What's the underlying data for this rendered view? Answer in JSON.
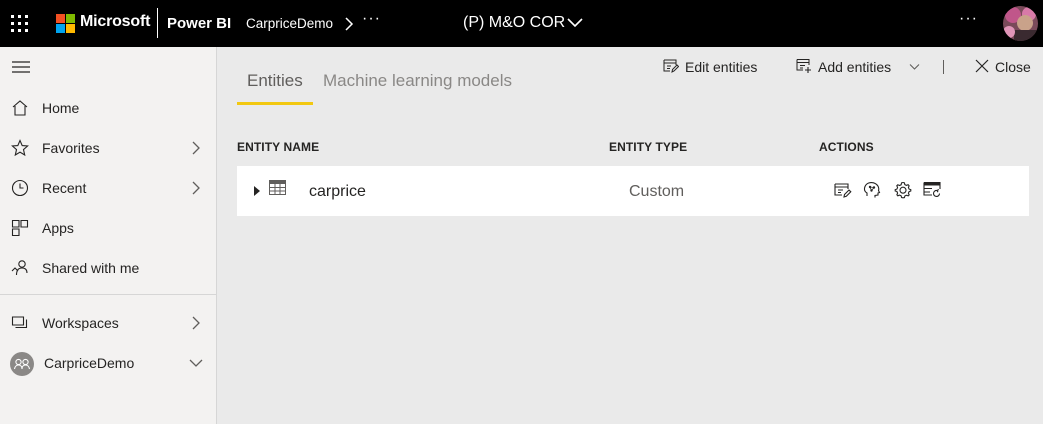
{
  "topbar": {
    "brand": "Microsoft",
    "app_name": "Power BI",
    "workspace": "CarpriceDemo",
    "crumb_more": "···",
    "environment": "(P) M&O COR",
    "more": "···"
  },
  "leftnav": {
    "items": [
      {
        "label": "Home",
        "icon": "home-icon"
      },
      {
        "label": "Favorites",
        "icon": "star-icon"
      },
      {
        "label": "Recent",
        "icon": "clock-icon"
      },
      {
        "label": "Apps",
        "icon": "apps-icon"
      },
      {
        "label": "Shared with me",
        "icon": "shared-icon"
      },
      {
        "label": "Workspaces",
        "icon": "workspaces-icon"
      },
      {
        "label": "CarpriceDemo",
        "icon": "workspace-avatar"
      }
    ]
  },
  "tabs": [
    {
      "label": "Entities",
      "active": true
    },
    {
      "label": "Machine learning models",
      "active": false
    }
  ],
  "commands": {
    "edit_entities": "Edit entities",
    "add_entities": "Add entities",
    "close": "Close"
  },
  "table": {
    "headers": [
      "ENTITY NAME",
      "ENTITY TYPE",
      "ACTIONS"
    ],
    "rows": [
      {
        "name": "carprice",
        "type": "Custom",
        "actions": [
          "edit-entity-icon",
          "ai-insights-icon",
          "settings-icon",
          "incremental-refresh-icon"
        ]
      }
    ]
  },
  "colors": {
    "topbar": "#000000",
    "accent": "#f2c811",
    "nav_bg": "#f3f2f1",
    "main_bg": "#eaeaea"
  }
}
